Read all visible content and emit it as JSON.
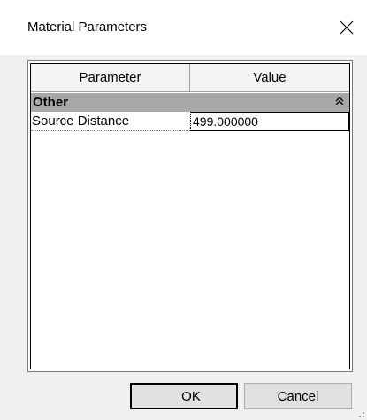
{
  "window": {
    "title": "Material Parameters"
  },
  "grid": {
    "columns": [
      "Parameter",
      "Value"
    ],
    "category": {
      "label": "Other",
      "icon": "collapse-up-icon"
    },
    "rows": [
      {
        "name": "Source Distance",
        "value": "499.000000"
      }
    ]
  },
  "buttons": {
    "ok": "OK",
    "cancel": "Cancel"
  }
}
